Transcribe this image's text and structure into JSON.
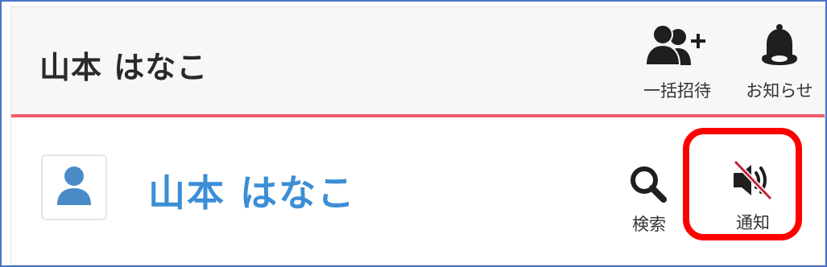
{
  "header": {
    "title": "山本 はなこ",
    "buttons": {
      "invite": {
        "label": "一括招待",
        "icon": "group-add-icon"
      },
      "notifications": {
        "label": "お知らせ",
        "icon": "bell-icon"
      }
    },
    "accent_color": "#f25c68"
  },
  "profile": {
    "name": "山本 はなこ",
    "name_color": "#3b8ed6",
    "avatar_icon": "user-icon",
    "actions": {
      "search": {
        "label": "検索",
        "icon": "search-icon"
      },
      "notify": {
        "label": "通知",
        "icon": "speaker-muted-icon"
      }
    }
  },
  "highlight_color": "#ff0000"
}
